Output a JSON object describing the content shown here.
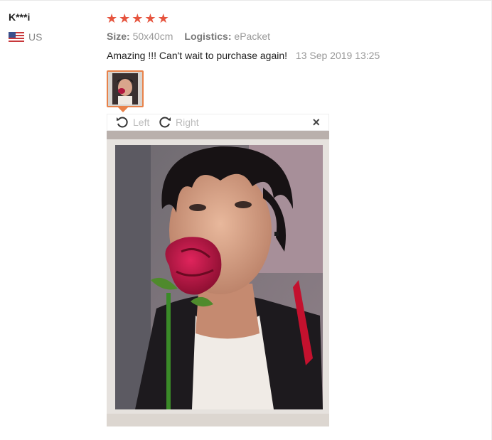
{
  "user": {
    "name": "K***i",
    "country_code": "US",
    "flag_icon": "us-flag-icon"
  },
  "rating": {
    "stars": 5,
    "max": 5,
    "color": "#e6543e"
  },
  "meta": {
    "size_label": "Size:",
    "size_value": "50x40cm",
    "logistics_label": "Logistics:",
    "logistics_value": "ePacket"
  },
  "review": {
    "text": "Amazing !!! Can't wait to purchase again!",
    "date": "13 Sep 2019 13:25"
  },
  "viewer": {
    "left_label": "Left",
    "right_label": "Right",
    "close_symbol": "×"
  },
  "colors": {
    "thumb_border": "#e8824a",
    "muted_text": "#999999"
  }
}
